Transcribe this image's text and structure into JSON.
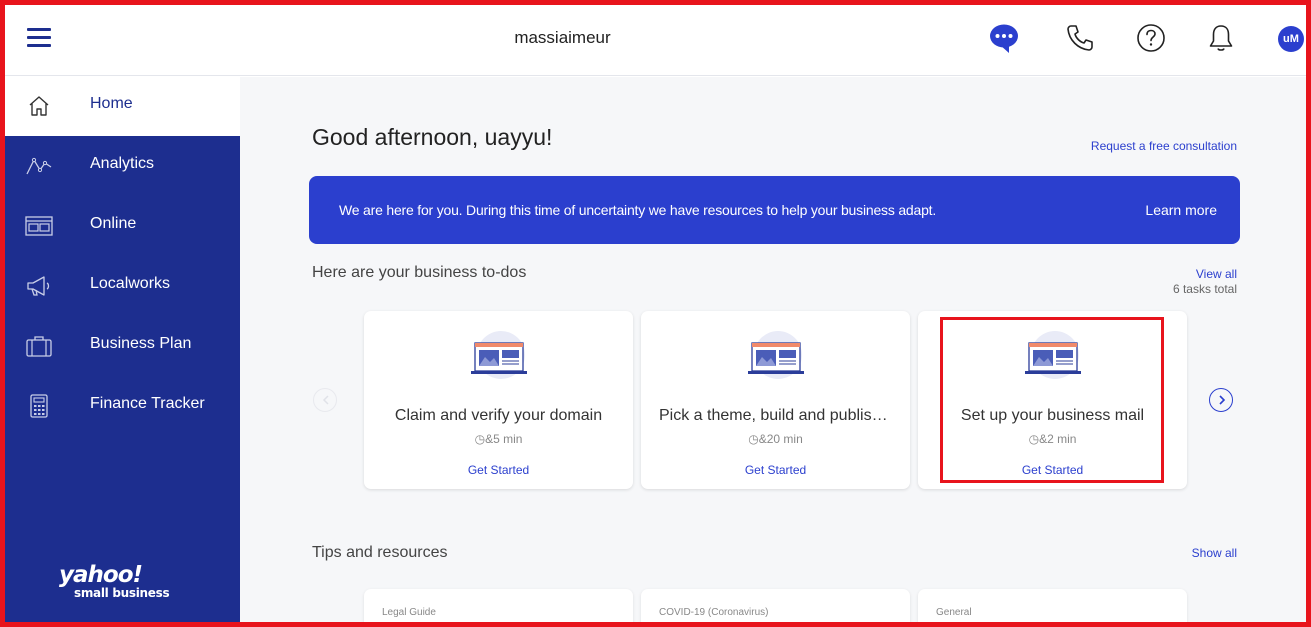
{
  "header": {
    "site_title": "massiaimeur",
    "avatar_initials": "uM",
    "icons": [
      "menu-icon",
      "chat-icon",
      "phone-icon",
      "help-icon",
      "bell-icon"
    ]
  },
  "sidebar": {
    "items": [
      {
        "label": "Home",
        "icon": "home-icon",
        "active": true
      },
      {
        "label": "Analytics",
        "icon": "analytics-icon"
      },
      {
        "label": "Online",
        "icon": "browser-icon"
      },
      {
        "label": "Localworks",
        "icon": "megaphone-icon"
      },
      {
        "label": "Business Plan",
        "icon": "briefcase-icon"
      },
      {
        "label": "Finance Tracker",
        "icon": "calculator-icon"
      }
    ],
    "logo_text": "yahoo!",
    "logo_subtext": "small business"
  },
  "main": {
    "greeting": "Good afternoon, uayyu!",
    "consult_link": "Request a free consultation",
    "banner": {
      "text": "We are here for you. During this time of uncertainty we have resources to help your business adapt.",
      "link": "Learn more"
    },
    "todos": {
      "title": "Here are your business to-dos",
      "view_all": "View all",
      "total": "6 tasks total",
      "cards": [
        {
          "title": "Claim and verify your domain",
          "time": "&5 min",
          "cta": "Get Started"
        },
        {
          "title": "Pick a theme, build and publish your website",
          "time": "&20 min",
          "cta": "Get Started"
        },
        {
          "title": "Set up your business mail",
          "time": "&2 min",
          "cta": "Get Started"
        }
      ]
    },
    "tips": {
      "title": "Tips and resources",
      "show_all": "Show all",
      "cards": [
        {
          "label": "Legal Guide"
        },
        {
          "label": "COVID-19 (Coronavirus)"
        },
        {
          "label": "General"
        }
      ]
    }
  },
  "colors": {
    "brand_blue": "#2b3fce",
    "sidebar_navy": "#1d2e8f",
    "highlight_red": "#e8141c"
  }
}
